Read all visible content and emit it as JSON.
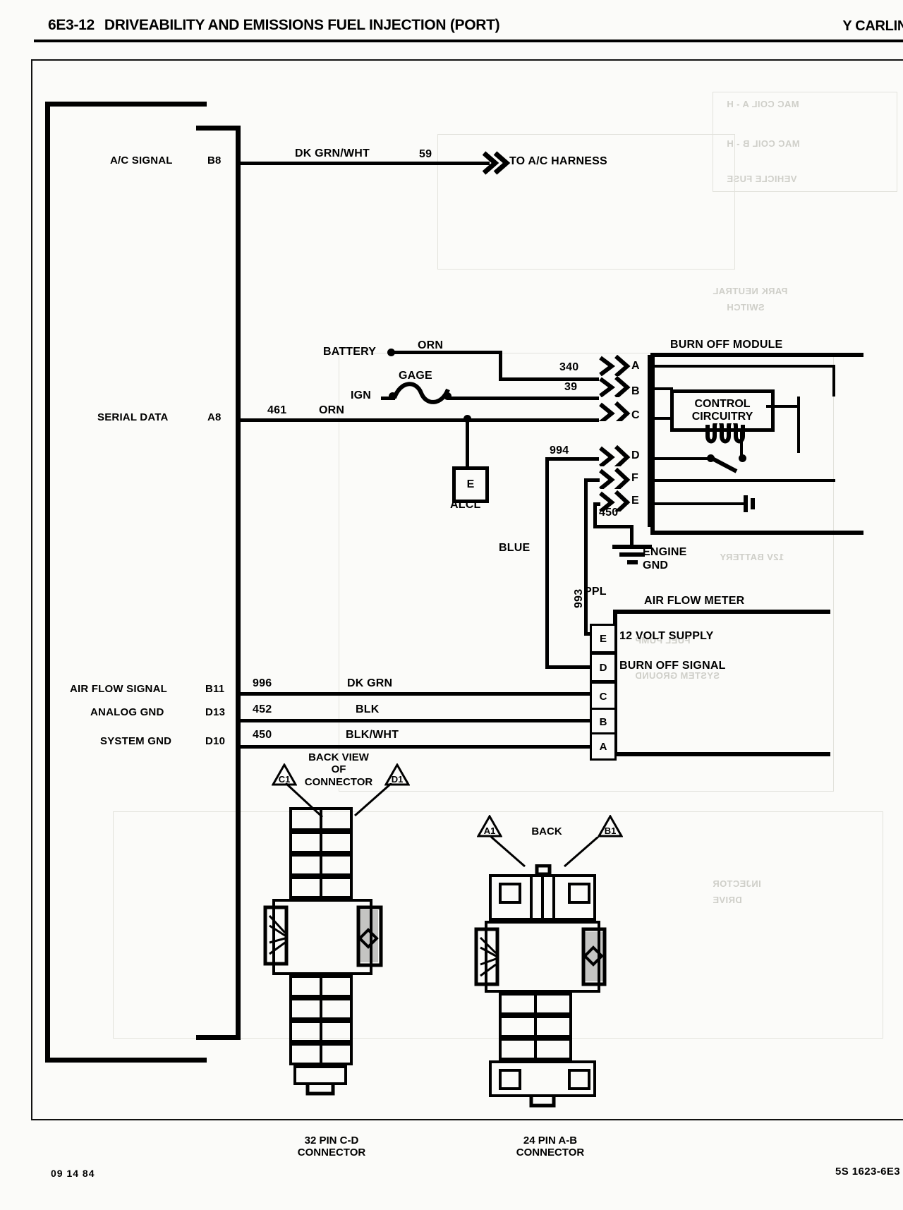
{
  "header": {
    "page_number": "6E3-12",
    "title": "DRIVEABILITY AND EMISSIONS FUEL INJECTION (PORT)",
    "right_label": "Y CARLIN"
  },
  "footer": {
    "left": "09 14 84",
    "right": "5S  1623-6E3"
  },
  "ecm": {
    "pins": [
      {
        "signal": "A/C SIGNAL",
        "pin": "B8"
      },
      {
        "signal": "SERIAL DATA",
        "pin": "A8"
      },
      {
        "signal": "AIR FLOW SIGNAL",
        "pin": "B11"
      },
      {
        "signal": "ANALOG GND",
        "pin": "D13"
      },
      {
        "signal": "SYSTEM GND",
        "pin": "D10"
      }
    ]
  },
  "wires": {
    "ac_signal": {
      "color": "DK GRN/WHT",
      "number": "59",
      "destination": "TO A/C HARNESS"
    },
    "serial_data": {
      "number": "461",
      "color": "ORN"
    },
    "battery_feed": {
      "source": "BATTERY",
      "color": "ORN",
      "number": "340"
    },
    "ign_feed": {
      "source": "IGN",
      "fuse": "GAGE",
      "number": "39"
    },
    "burn_off_994": {
      "number": "994",
      "color": "BLUE"
    },
    "ground_450": {
      "number": "450",
      "label": "ENGINE\nGND"
    },
    "supply_993": {
      "number": "993",
      "color": "PPL"
    },
    "air_flow_signal": {
      "number": "996",
      "color": "DK GRN"
    },
    "analog_gnd": {
      "number": "452",
      "color": "BLK"
    },
    "system_gnd": {
      "number": "450",
      "color": "BLK/WHT"
    }
  },
  "burn_off_module": {
    "title": "BURN OFF MODULE",
    "inner_label": "CONTROL\nCIRCUITRY",
    "terminals": [
      "A",
      "B",
      "C",
      "D",
      "F",
      "E"
    ]
  },
  "air_flow_meter": {
    "title": "AIR FLOW METER",
    "terminals": [
      {
        "pin": "E",
        "label": "12 VOLT SUPPLY"
      },
      {
        "pin": "D",
        "label": "BURN OFF SIGNAL"
      },
      {
        "pin": "C",
        "label": ""
      },
      {
        "pin": "B",
        "label": ""
      },
      {
        "pin": "A",
        "label": ""
      }
    ]
  },
  "alcl": {
    "terminal": "E",
    "label": "ALCL"
  },
  "connectors": {
    "back_view_note": "BACK VIEW\nOF\nCONNECTOR",
    "back_note": "BACK",
    "left": {
      "caption": "32 PIN C-D\nCONNECTOR",
      "markers": [
        "C1",
        "D1"
      ]
    },
    "right": {
      "caption": "24 PIN A-B\nCONNECTOR",
      "markers": [
        "A1",
        "B1"
      ]
    }
  },
  "ghost_text": [
    "MAC COIL  A - H",
    "MAC COIL  B - H",
    "VEHICLE FUSE",
    "PARK NEUTRAL",
    "SWITCH",
    "12V BATTERY",
    "FUEL PUMP",
    "SYSTEM GROUND",
    "INJECTOR",
    "DRIVE"
  ]
}
